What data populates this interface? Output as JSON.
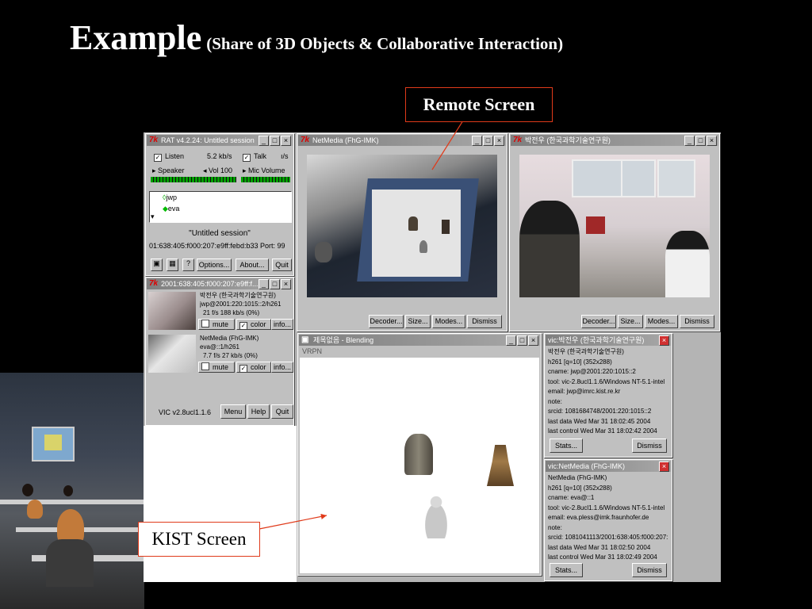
{
  "slide": {
    "title": "Example",
    "subtitle": "(Share of 3D Objects & Collaborative Interaction)"
  },
  "callouts": {
    "remote": "Remote Screen",
    "kist": "KIST Screen"
  },
  "rat": {
    "title": "RAT v4.2.24: Untitled session",
    "listen": "Listen",
    "listen_rate": "5.2 kb/s",
    "talk": "Talk",
    "talk_rate": "ı/s",
    "speaker": "Speaker",
    "vol": "Vol 100",
    "mic": "Mic Volume",
    "participants": [
      "jwp",
      "eva"
    ],
    "session_name": "\"Untitled session\"",
    "session_addr": "01:638:405:f000:207:e9ff:febd:b33 Port: 99",
    "btn_options": "Options...",
    "btn_about": "About...",
    "btn_quit": "Quit"
  },
  "vic": {
    "title": "2001:638:405:f000:207:e9ff:f...",
    "entries": [
      {
        "name": "박전우 (한국과학기술연구원)",
        "addr": "jwp@2001:220:1015::2/h261",
        "stats": "21 f/s    188 kb/s    (0%)"
      },
      {
        "name": "NetMedia (FhG-IMK)",
        "addr": "eva@::1/h261",
        "stats": "7.7 f/s    27 kb/s    (0%)"
      }
    ],
    "mute": "mute",
    "color": "color",
    "info": "info...",
    "version": "VIC v2.8ucl1.1.6",
    "btn_menu": "Menu",
    "btn_help": "Help",
    "btn_quit": "Quit"
  },
  "netmedia_window": {
    "title": "NetMedia (FhG-IMK)",
    "buttons": [
      "Decoder...",
      "Size...",
      "Modes...",
      "Dismiss"
    ]
  },
  "kist_window": {
    "title": "박전우 (한국과학기술연구원)",
    "buttons": [
      "Decoder...",
      "Size...",
      "Modes...",
      "Dismiss"
    ]
  },
  "vrpn_window": {
    "title": "제목없음 - Blending",
    "menu": "VRPN"
  },
  "info1": {
    "title": "vic:박전우 (한국과학기술연구원)",
    "lines": [
      "박전우 (한국과학기술연구원)",
      "h261 [q=10] (352x288)",
      "cname: jwp@2001:220:1015::2",
      "tool: vic-2.8ucl1.1.6/Windows NT-5.1-intel",
      "email: jwp@imrc.kist.re.kr",
      "note:",
      "srcid: 1081684748/2001:220:1015::2",
      "last data Wed Mar 31 18:02:45 2004",
      "last control Wed Mar 31 18:02:42 2004"
    ],
    "btn_stats": "Stats...",
    "btn_dismiss": "Dismiss"
  },
  "info2": {
    "title": "vic:NetMedia (FhG-IMK)",
    "lines": [
      "NetMedia (FhG-IMK)",
      "h261 [q=10] (352x288)",
      "cname: eva@::1",
      "tool: vic-2.8ucl1.1.6/Windows NT-5.1-intel",
      "email: eva.pless@imk.fraunhofer.de",
      "note:",
      "srcid: 1081041113/2001:638:405:f000:207:",
      "last data Wed Mar 31 18:02:50 2004",
      "last control Wed Mar 31 18:02:49 2004"
    ],
    "btn_stats": "Stats...",
    "btn_dismiss": "Dismiss"
  },
  "colors": {
    "background": "#000000",
    "callout_border": "#e03a1a",
    "title_text": "#ffffff",
    "window_gray": "#c0c0c0"
  }
}
